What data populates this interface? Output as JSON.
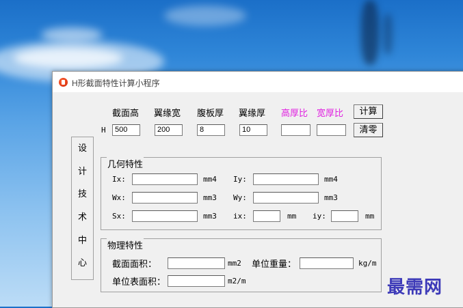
{
  "window": {
    "title": "H形截面特性计算小程序",
    "minimize_glyph": "—"
  },
  "inputs": {
    "headers": {
      "height": "截面高",
      "flange_width": "翼缘宽",
      "web_thickness": "腹板厚",
      "flange_thickness": "翼缘厚",
      "height_thickness_ratio": "高厚比",
      "width_thickness_ratio": "宽厚比"
    },
    "row_label": "H",
    "values": {
      "height": "500",
      "flange_width": "200",
      "web_thickness": "8",
      "flange_thickness": "10",
      "height_thickness_ratio": "",
      "width_thickness_ratio": ""
    },
    "calc_button": "计算",
    "clear_button": "清零"
  },
  "dept_chars": [
    "设",
    "计",
    "技",
    "术",
    "中",
    "心"
  ],
  "geometry": {
    "title": "几何特性",
    "ix_label": "Ix:",
    "ix_value": "",
    "ix_unit": "mm4",
    "iy_label": "Iy:",
    "iy_value": "",
    "iy_unit": "mm4",
    "wx_label": "Wx:",
    "wx_value": "",
    "wx_unit": "mm3",
    "wy_label": "Wy:",
    "wy_value": "",
    "wy_unit": "mm3",
    "sx_label": "Sx:",
    "sx_value": "",
    "sx_unit": "mm3",
    "ix_r_label": "ix:",
    "ix_r_value": "",
    "ix_r_unit": "mm",
    "iy_r_label": "iy:",
    "iy_r_value": "",
    "iy_r_unit": "mm"
  },
  "physical": {
    "title": "物理特性",
    "area_label": "截面面积：",
    "area_value": "",
    "area_unit": "mm2",
    "weight_label": "单位重量：",
    "weight_value": "",
    "weight_unit": "kg/m",
    "surface_label": "单位表面积：",
    "surface_value": "",
    "surface_unit": "m2/m"
  },
  "watermark": "最需网",
  "colors": {
    "ratio_label": "#e020e0",
    "watermark": "#3d3ab8"
  },
  "icons": {
    "app": "app-logo-icon"
  }
}
